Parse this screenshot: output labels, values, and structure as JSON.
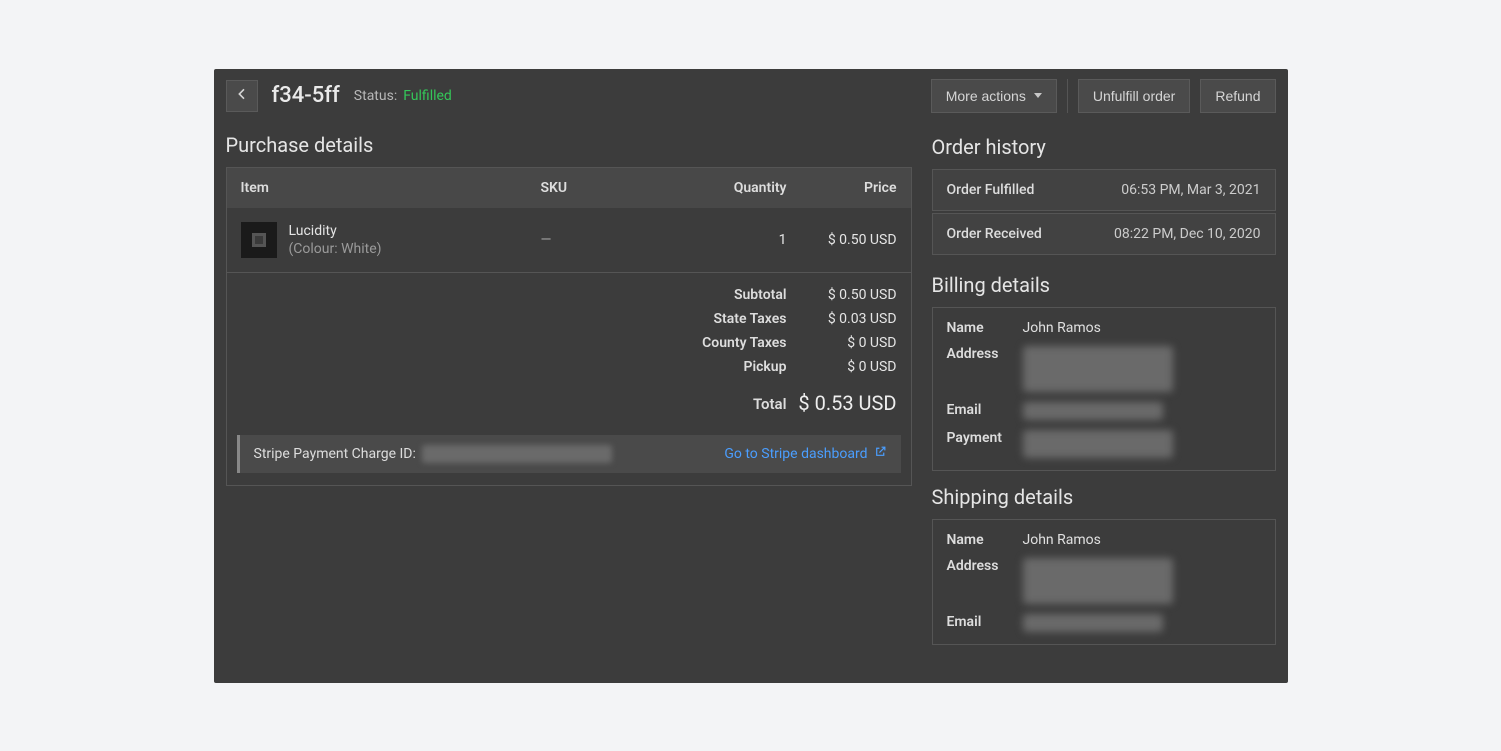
{
  "header": {
    "order_id": "f34-5ff",
    "status_label": "Status:",
    "status_value": "Fulfilled",
    "actions": {
      "more": "More actions",
      "unfulfill": "Unfulfill order",
      "refund": "Refund"
    }
  },
  "purchase": {
    "title": "Purchase details",
    "columns": {
      "item": "Item",
      "sku": "SKU",
      "quantity": "Quantity",
      "price": "Price"
    },
    "items": [
      {
        "name": "Lucidity",
        "variant": "(Colour: White)",
        "sku": "—",
        "quantity": "1",
        "price": "$ 0.50 USD"
      }
    ],
    "summary": {
      "subtotal_label": "Subtotal",
      "subtotal_value": "$ 0.50 USD",
      "state_taxes_label": "State Taxes",
      "state_taxes_value": "$ 0.03 USD",
      "county_taxes_label": "County Taxes",
      "county_taxes_value": "$ 0 USD",
      "pickup_label": "Pickup",
      "pickup_value": "$ 0 USD",
      "total_label": "Total",
      "total_value": "$ 0.53 USD"
    },
    "stripe": {
      "label": "Stripe Payment Charge ID:",
      "link_text": "Go to Stripe dashboard"
    }
  },
  "history": {
    "title": "Order history",
    "entries": [
      {
        "event": "Order Fulfilled",
        "timestamp": "06:53 PM, Mar 3, 2021"
      },
      {
        "event": "Order Received",
        "timestamp": "08:22 PM, Dec 10, 2020"
      }
    ]
  },
  "billing": {
    "title": "Billing details",
    "labels": {
      "name": "Name",
      "address": "Address",
      "email": "Email",
      "payment": "Payment"
    },
    "name": "John Ramos"
  },
  "shipping": {
    "title": "Shipping details",
    "labels": {
      "name": "Name",
      "address": "Address",
      "email": "Email"
    },
    "name": "John Ramos"
  }
}
